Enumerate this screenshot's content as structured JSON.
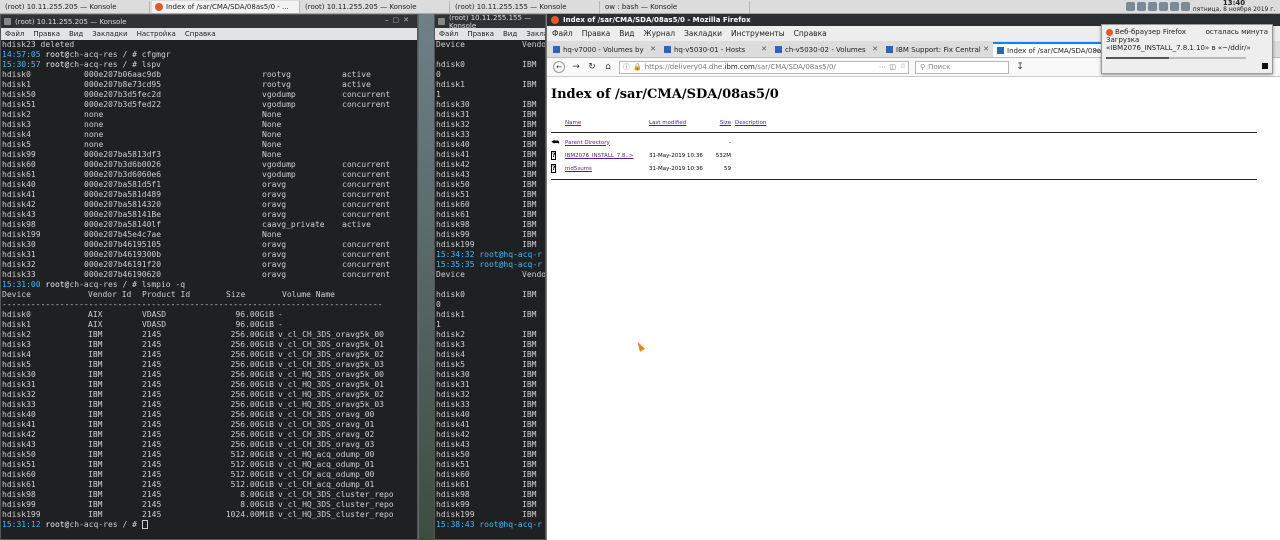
{
  "taskbar": {
    "tasks": [
      {
        "label": "(root) 10.11.255.205 — Konsole",
        "icon": "konsole-icon"
      },
      {
        "label": "Index of /sar/CMA/SDA/08as5/0 - ...",
        "icon": "firefox-icon"
      },
      {
        "label": "(root) 10.11.255.205 — Konsole",
        "icon": "konsole-icon"
      },
      {
        "label": "(root) 10.11.255.155 — Konsole",
        "icon": "konsole-icon"
      },
      {
        "label": "ow : bash — Konsole",
        "icon": "konsole-icon"
      }
    ],
    "clock_time": "13:40",
    "clock_date": "пятница, 8 ноября 2019 г."
  },
  "konsole_left": {
    "title": "(root) 10.11.255.205 — Konsole",
    "menu": [
      "Файл",
      "Правка",
      "Вид",
      "Закладки",
      "Настройка",
      "Справка"
    ],
    "top_lines": [
      "hdisk23 deleted"
    ],
    "prompts": [
      {
        "time": "14:57:05",
        "host": "ch-acq-res",
        "cmd": "cfgmgr"
      },
      {
        "time": "15:30:57",
        "host": "ch-acq-res",
        "cmd": "lspv"
      }
    ],
    "lspv": [
      [
        "hdisk0",
        "000e207b06aac9db",
        "rootvg",
        "active"
      ],
      [
        "hdisk1",
        "000e207b8e73cd95",
        "rootvg",
        "active"
      ],
      [
        "hdisk50",
        "000e207b3d5fec2d",
        "vgodump",
        "concurrent"
      ],
      [
        "hdisk51",
        "000e207b3d5fed22",
        "vgodump",
        "concurrent"
      ],
      [
        "hdisk2",
        "none",
        "None",
        ""
      ],
      [
        "hdisk3",
        "none",
        "None",
        ""
      ],
      [
        "hdisk4",
        "none",
        "None",
        ""
      ],
      [
        "hdisk5",
        "none",
        "None",
        ""
      ],
      [
        "hdisk99",
        "000e207ba5813df3",
        "None",
        ""
      ],
      [
        "hdisk60",
        "000e207b3d6b0026",
        "vgodump",
        "concurrent"
      ],
      [
        "hdisk61",
        "000e207b3d6060e6",
        "vgodump",
        "concurrent"
      ],
      [
        "hdisk40",
        "000e207ba581d5f1",
        "oravg",
        "concurrent"
      ],
      [
        "hdisk41",
        "000e207ba581d489",
        "oravg",
        "concurrent"
      ],
      [
        "hdisk42",
        "000e207ba5814320",
        "oravg",
        "concurrent"
      ],
      [
        "hdisk43",
        "000e207ba58141Be",
        "oravg",
        "concurrent"
      ],
      [
        "hdisk98",
        "000e207ba58140lf",
        "caavg_private",
        "active"
      ],
      [
        "hdisk199",
        "000e207b45e4c7ae",
        "None",
        ""
      ],
      [
        "hdisk30",
        "000e207b46195105",
        "oravg",
        "concurrent"
      ],
      [
        "hdisk31",
        "000e207b4619300b",
        "oravg",
        "concurrent"
      ],
      [
        "hdisk32",
        "000e207b46191f20",
        "oravg",
        "concurrent"
      ],
      [
        "hdisk33",
        "000e207b46190620",
        "oravg",
        "concurrent"
      ]
    ],
    "prompt3": {
      "time": "15:31:00",
      "host": "ch-acq-res",
      "cmd": "lsmpio -q"
    },
    "lsmpio_header": [
      "Device",
      "Vendor Id",
      "Product Id",
      "Size",
      "Volume Name"
    ],
    "lsmpio_sep": "-------------------------------------------------------------------------------",
    "lsmpio": [
      [
        "hdisk0",
        "AIX",
        "VDASD",
        "96.00GiB",
        "-"
      ],
      [
        "hdisk1",
        "AIX",
        "VDASD",
        "96.00GiB",
        "-"
      ],
      [
        "hdisk2",
        "IBM",
        "2145",
        "256.00GiB",
        "v_cl_CH_3DS_oravg5k_00"
      ],
      [
        "hdisk3",
        "IBM",
        "2145",
        "256.00GiB",
        "v_cl_CH_3DS_oravg5k_01"
      ],
      [
        "hdisk4",
        "IBM",
        "2145",
        "256.00GiB",
        "v_cl_CH_3DS_oravg5k_02"
      ],
      [
        "hdisk5",
        "IBM",
        "2145",
        "256.00GiB",
        "v_cl_CH_3DS_oravg5k_03"
      ],
      [
        "hdisk30",
        "IBM",
        "2145",
        "256.00GiB",
        "v_cl_HQ_3DS_oravg5k_00"
      ],
      [
        "hdisk31",
        "IBM",
        "2145",
        "256.00GiB",
        "v_cl_HQ_3DS_oravg5k_01"
      ],
      [
        "hdisk32",
        "IBM",
        "2145",
        "256.00GiB",
        "v_cl_HQ_3DS_oravg5k_02"
      ],
      [
        "hdisk33",
        "IBM",
        "2145",
        "256.00GiB",
        "v_cl_HQ_3DS_oravg5k_03"
      ],
      [
        "hdisk40",
        "IBM",
        "2145",
        "256.00GiB",
        "v_cl_CH_3DS_oravg_00"
      ],
      [
        "hdisk41",
        "IBM",
        "2145",
        "256.00GiB",
        "v_cl_CH_3DS_oravg_01"
      ],
      [
        "hdisk42",
        "IBM",
        "2145",
        "256.00GiB",
        "v_cl_CH_3DS_oravg_02"
      ],
      [
        "hdisk43",
        "IBM",
        "2145",
        "256.00GiB",
        "v_cl_CH_3DS_oravg_03"
      ],
      [
        "hdisk50",
        "IBM",
        "2145",
        "512.00GiB",
        "v_cl_HQ_acq_odump_00"
      ],
      [
        "hdisk51",
        "IBM",
        "2145",
        "512.00GiB",
        "v_cl_HQ_acq_odump_01"
      ],
      [
        "hdisk60",
        "IBM",
        "2145",
        "512.00GiB",
        "v_cl_CH_acq_odump_00"
      ],
      [
        "hdisk61",
        "IBM",
        "2145",
        "512.00GiB",
        "v_cl_CH_acq_odump_01"
      ],
      [
        "hdisk98",
        "IBM",
        "2145",
        "8.00GiB",
        "v_cl_CH_3DS_cluster_repo"
      ],
      [
        "hdisk99",
        "IBM",
        "2145",
        "8.00GiB",
        "v_cl_HQ_3DS_cluster_repo"
      ],
      [
        "hdisk199",
        "IBM",
        "2145",
        "1024.00MiB",
        "v_cl_HQ_3DS_cluster_repo"
      ]
    ],
    "prompt4": {
      "time": "15:31:12",
      "host": "ch-acq-res",
      "cmd": ""
    }
  },
  "konsole_right": {
    "title": "(root) 10.11.255.155 — Konsole",
    "menu": [
      "Файл",
      "Правка",
      "Вид",
      "Закладки"
    ],
    "lines": [
      [
        "Device",
        "Vendo"
      ],
      [
        "",
        ""
      ],
      [
        "hdisk0",
        "IBM"
      ],
      [
        "0",
        ""
      ],
      [
        "hdisk1",
        "IBM"
      ],
      [
        "1",
        ""
      ],
      [
        "hdisk30",
        "IBM"
      ],
      [
        "hdisk31",
        "IBM"
      ],
      [
        "hdisk32",
        "IBM"
      ],
      [
        "hdisk33",
        "IBM"
      ],
      [
        "hdisk40",
        "IBM"
      ],
      [
        "hdisk41",
        "IBM"
      ],
      [
        "hdisk42",
        "IBM"
      ],
      [
        "hdisk43",
        "IBM"
      ],
      [
        "hdisk50",
        "IBM"
      ],
      [
        "hdisk51",
        "IBM"
      ],
      [
        "hdisk60",
        "IBM"
      ],
      [
        "hdisk61",
        "IBM"
      ],
      [
        "hdisk98",
        "IBM"
      ],
      [
        "hdisk99",
        "IBM"
      ],
      [
        "hdisk199",
        "IBM"
      ],
      [
        "15:34:32 root@hq-acq-r",
        ""
      ],
      [
        "15:35:35 root@hq-acq-r",
        ""
      ],
      [
        "Device",
        "Vendo"
      ],
      [
        "",
        ""
      ],
      [
        "hdisk0",
        "IBM"
      ],
      [
        "0",
        ""
      ],
      [
        "hdisk1",
        "IBM"
      ],
      [
        "1",
        ""
      ],
      [
        "hdisk2",
        "IBM"
      ],
      [
        "hdisk3",
        "IBM"
      ],
      [
        "hdisk4",
        "IBM"
      ],
      [
        "hdisk5",
        "IBM"
      ],
      [
        "hdisk30",
        "IBM"
      ],
      [
        "hdisk31",
        "IBM"
      ],
      [
        "hdisk32",
        "IBM"
      ],
      [
        "hdisk33",
        "IBM"
      ],
      [
        "hdisk40",
        "IBM"
      ],
      [
        "hdisk41",
        "IBM"
      ],
      [
        "hdisk42",
        "IBM"
      ],
      [
        "hdisk43",
        "IBM"
      ],
      [
        "hdisk50",
        "IBM"
      ],
      [
        "hdisk51",
        "IBM"
      ],
      [
        "hdisk60",
        "IBM"
      ],
      [
        "hdisk61",
        "IBM"
      ],
      [
        "hdisk98",
        "IBM"
      ],
      [
        "hdisk99",
        "IBM"
      ],
      [
        "hdisk199",
        "IBM"
      ],
      [
        "15:38:43 root@hq-acq-r",
        ""
      ]
    ]
  },
  "firefox": {
    "title": "Index of /sar/CMA/SDA/08as5/0 - Mozilla Firefox",
    "menu": [
      "Файл",
      "Правка",
      "Вид",
      "Журнал",
      "Закладки",
      "Инструменты",
      "Справка"
    ],
    "tabs": [
      {
        "label": "hq-v7000 - Volumes by",
        "active": false
      },
      {
        "label": "hq-v5030-01 - Hosts",
        "active": false
      },
      {
        "label": "ch-v5030-02 - Volumes",
        "active": false
      },
      {
        "label": "IBM Support: Fix Central",
        "active": false
      },
      {
        "label": "Index of /sar/CMA/SDA/08as",
        "active": true
      }
    ],
    "url_prefix": "https://delivery04.dhe.",
    "url_domain": "ibm.com",
    "url_suffix": "/sar/CMA/SDA/08as5/0/",
    "search_placeholder": "Поиск",
    "page_heading": "Index of /sar/CMA/SDA/08as5/0",
    "columns": [
      "Name",
      "Last modified",
      "Size",
      "Description"
    ],
    "parent": {
      "name": "Parent Directory",
      "size": "-"
    },
    "files": [
      {
        "name": "IBM2076_INSTALL_7.8..>",
        "modified": "31-May-2019 10:36",
        "size": "532M"
      },
      {
        "name": "md5sums",
        "modified": "31-May-2019 10:36",
        "size": "59"
      }
    ]
  },
  "download": {
    "source": "Веб-браузер Firefox",
    "remaining": "осталась минута",
    "heading": "Загрузка",
    "file": "«IBM2076_INSTALL_7.8.1.10» в «~/ddir/»",
    "progress": 0.45
  }
}
